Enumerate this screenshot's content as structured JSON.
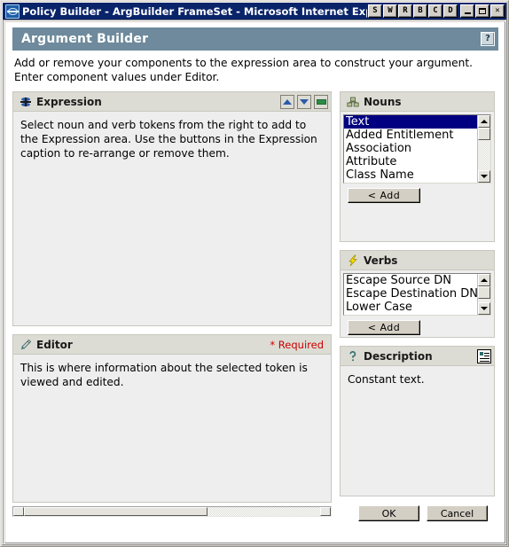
{
  "window": {
    "title": "Policy Builder - ArgBuilder FrameSet - Microsoft Internet Explorer",
    "icon": "ie-document-icon",
    "toolbar_letters": [
      "S",
      "W",
      "R",
      "B",
      "C",
      "D"
    ],
    "minimize_label": "_",
    "maximize_label": "□",
    "close_label": "✕"
  },
  "header": {
    "title": "Argument Builder",
    "help_label": "?",
    "bar_color": "#6e8a9c"
  },
  "intro": {
    "text": "Add or remove your components to the expression area to construct your argument. Enter component values under Editor."
  },
  "expression": {
    "caption": "Expression",
    "icon": "expression-stack-icon",
    "body_text": "Select noun and verb tokens from the right to add to the Expression area.  Use the buttons in the Expression caption to re-arrange or remove them.",
    "buttons": [
      {
        "name": "move-up",
        "glyph": "triangle-up"
      },
      {
        "name": "move-down",
        "glyph": "triangle-down"
      },
      {
        "name": "remove",
        "glyph": "minus-box"
      }
    ]
  },
  "editor": {
    "caption": "Editor",
    "icon": "pencil-icon",
    "required_label": "* Required",
    "required_color": "#cc0000",
    "body_text": "This is where information about the selected token is viewed and edited."
  },
  "nouns": {
    "caption": "Nouns",
    "icon": "blocks-icon",
    "items": [
      "Text",
      "Added Entitlement",
      "Association",
      "Attribute",
      "Class Name"
    ],
    "selected_index": 0,
    "selected_color": "#000080",
    "add_label": "< Add"
  },
  "verbs": {
    "caption": "Verbs",
    "icon": "lightning-icon",
    "items": [
      "Escape Source DN",
      "Escape Destination DN",
      "Lower Case"
    ],
    "selected_index": -1,
    "add_label": "< Add"
  },
  "description": {
    "caption": "Description",
    "icon": "question-key-icon",
    "doc_icon": "document-list-icon",
    "body_text": "Constant text."
  },
  "dialog": {
    "ok_label": "OK",
    "cancel_label": "Cancel"
  },
  "scrollbar": {
    "horizontal_thumb_percent": 62,
    "left_arrow": "◄",
    "right_arrow": "►"
  }
}
